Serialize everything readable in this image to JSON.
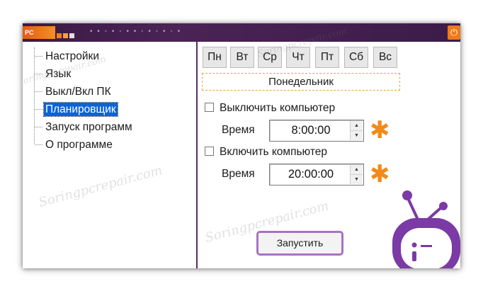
{
  "titlebar": {
    "logo_text": "PC",
    "power_icon": "power-icon"
  },
  "sidebar": {
    "items": [
      {
        "label": "Настройки"
      },
      {
        "label": "Язык"
      },
      {
        "label": "Выкл/Вкл ПК"
      },
      {
        "label": "Планировщик"
      },
      {
        "label": "Запуск программ"
      },
      {
        "label": "О программе"
      }
    ],
    "selected_index": 3
  },
  "main": {
    "days": [
      "Пн",
      "Вт",
      "Ср",
      "Чт",
      "Пт",
      "Сб",
      "Вс"
    ],
    "selected_day": "Понедельник",
    "shutdown": {
      "label": "Выключить компьютер",
      "time_label": "Время",
      "time_value": "8:00:00",
      "checked": false
    },
    "startup": {
      "label": "Включить компьютер",
      "time_label": "Время",
      "time_value": "20:00:00",
      "checked": false
    },
    "start_button": "Запустить"
  },
  "watermark": "Soringpcrepair.com",
  "colors": {
    "titlebar": "#4b2356",
    "accent_orange": "#f28a1a",
    "mascot_purple": "#7b3aa5",
    "selection_blue": "#0a64d6"
  }
}
